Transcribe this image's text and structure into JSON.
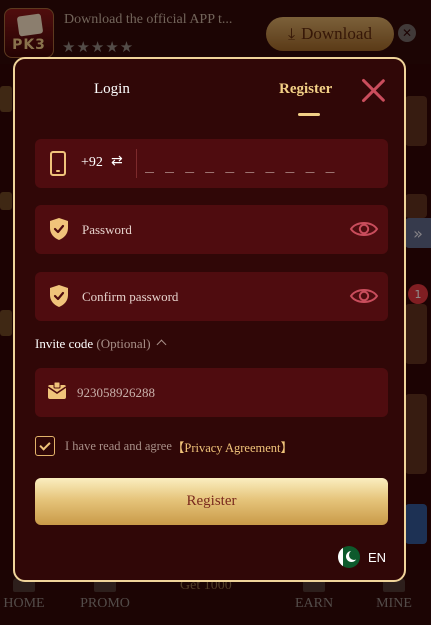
{
  "banner": {
    "app_icon_text": "PK3",
    "text": "Download the official APP t...",
    "stars": "★★★★★",
    "download_label": "Download",
    "close_glyph": "✕"
  },
  "side": {
    "arrow_glyph": "»",
    "badge_count": "1"
  },
  "bottom_nav": {
    "home": "HOME",
    "promo": "PROMO",
    "get": "Get 1000",
    "earn": "EARN",
    "mine": "MINE"
  },
  "modal": {
    "tabs": {
      "login": "Login",
      "register": "Register"
    },
    "active_tab": "Register",
    "phone": {
      "country_code": "+92",
      "swap_glyph": "⇄",
      "placeholder": "_ _ _ _ _ _ _ _ _ _",
      "value": ""
    },
    "password": {
      "placeholder": "Password"
    },
    "confirm_password": {
      "placeholder": "Confirm password"
    },
    "invite": {
      "label": "Invite code",
      "optional": "(Optional)",
      "value": "923058926288"
    },
    "agree": {
      "checked": true,
      "text": "I have read and agree",
      "link": "【Privacy Agreement】"
    },
    "submit_label": "Register",
    "language": "EN"
  },
  "colors": {
    "accent_gold": "#f2cf86",
    "modal_bg": "#300707",
    "field_bg": "#4f0c0f",
    "close_red": "#c94d5c"
  },
  "icons": {
    "phone": "phone-icon",
    "shield": "shield-icon",
    "eye": "eye-icon",
    "envelope": "envelope-icon",
    "flag": "flag-icon",
    "close": "close-icon"
  }
}
